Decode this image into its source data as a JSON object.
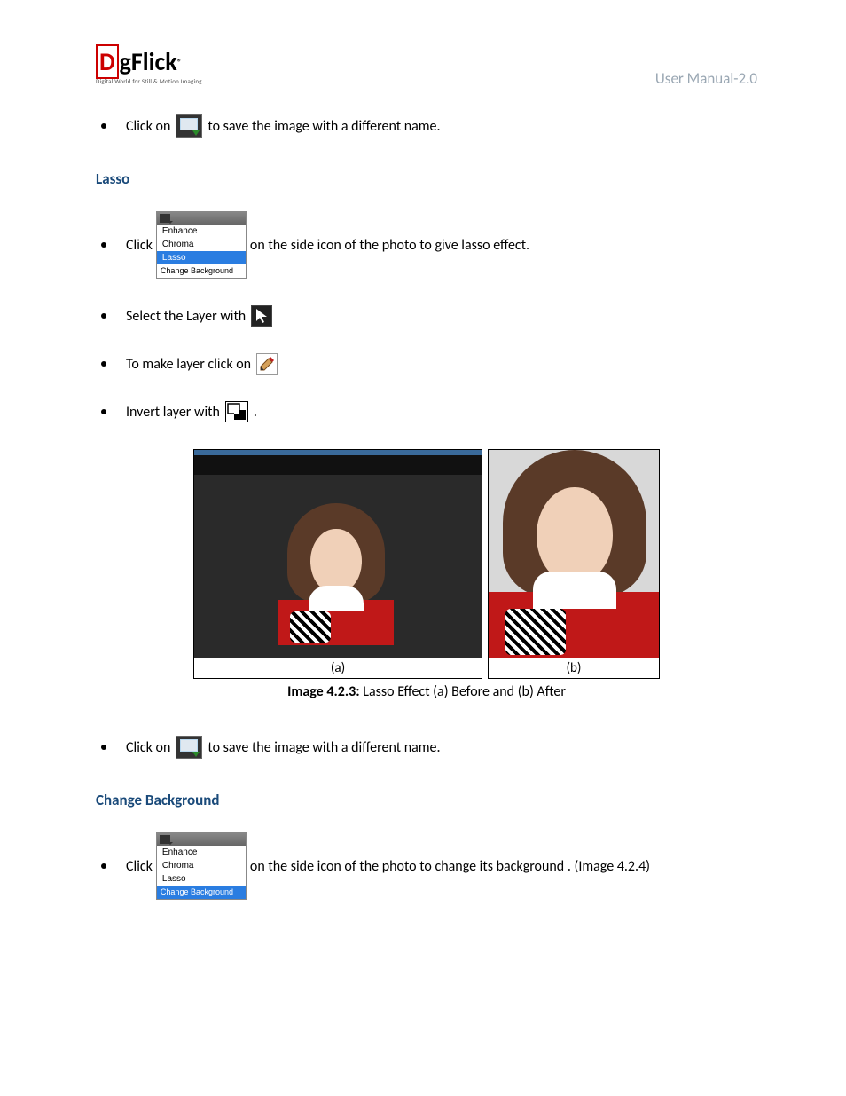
{
  "header": {
    "logo_main_d": "D",
    "logo_main_rest": "gFlick",
    "logo_reg": "®",
    "logo_sub": "Digital World for Still & Motion Imaging",
    "right": "User Manual-2.0"
  },
  "bullets_top": {
    "b1_pre": "Click on",
    "b1_post": " to save the image with a different name."
  },
  "section_lasso": {
    "title": "Lasso",
    "menu": {
      "item1": "Enhance",
      "item2": "Chroma",
      "item3": "Lasso",
      "item4": "Change Background"
    },
    "b1_pre": "Click",
    "b1_post": " on the side icon of the photo to give lasso effect.",
    "b2": "Select the Layer with",
    "b3": "To make layer click on",
    "b4_pre": "Invert layer with",
    "b4_post": " ."
  },
  "figure": {
    "label_a": "(a)",
    "label_b": "(b)",
    "caption_bold": "Image 4.2.3:",
    "caption_rest": " Lasso Effect (a) Before and (b) After"
  },
  "bullets_mid": {
    "b1_pre": "Click on",
    "b1_post": " to save the image with a different name."
  },
  "section_changebg": {
    "title": "Change Background",
    "menu": {
      "item1": "Enhance",
      "item2": "Chroma",
      "item3": "Lasso",
      "item4": "Change Background"
    },
    "b1_pre": "Click",
    "b1_post": " on the side icon of the photo to change its background . (Image 4.2.4)"
  }
}
